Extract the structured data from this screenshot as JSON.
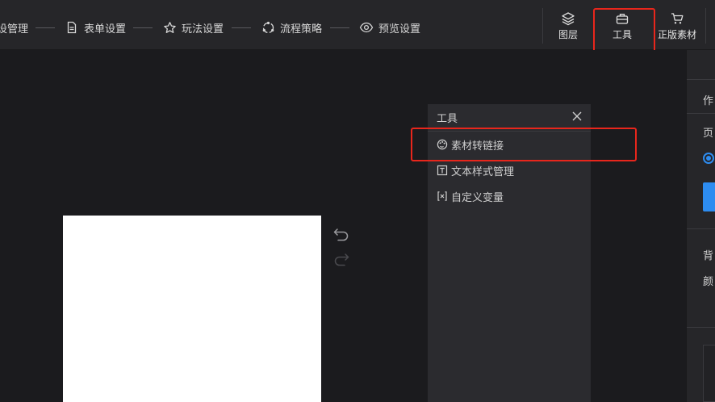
{
  "steps": [
    {
      "label": "设管理",
      "icon": "none"
    },
    {
      "label": "表单设置",
      "icon": "document-icon"
    },
    {
      "label": "玩法设置",
      "icon": "star-icon"
    },
    {
      "label": "流程策略",
      "icon": "flow-icon"
    },
    {
      "label": "预览设置",
      "icon": "eye-icon"
    }
  ],
  "toolbar": {
    "layers_label": "图层",
    "tools_label": "工具",
    "assets_label": "正版素材"
  },
  "tool_panel": {
    "title": "工具",
    "items": [
      {
        "label": "素材转链接",
        "icon": "link-palette-icon"
      },
      {
        "label": "文本样式管理",
        "icon": "text-style-icon"
      },
      {
        "label": "自定义变量",
        "icon": "variable-icon"
      }
    ]
  },
  "right_panel": {
    "line1": "作",
    "line2": "页",
    "line3": "背",
    "line4": "颜"
  },
  "colors": {
    "highlight": "#e8261c",
    "accent": "#2d8cf0",
    "panel_bg": "#2b2b2f",
    "canvas_bg": "#1b1b1e"
  }
}
